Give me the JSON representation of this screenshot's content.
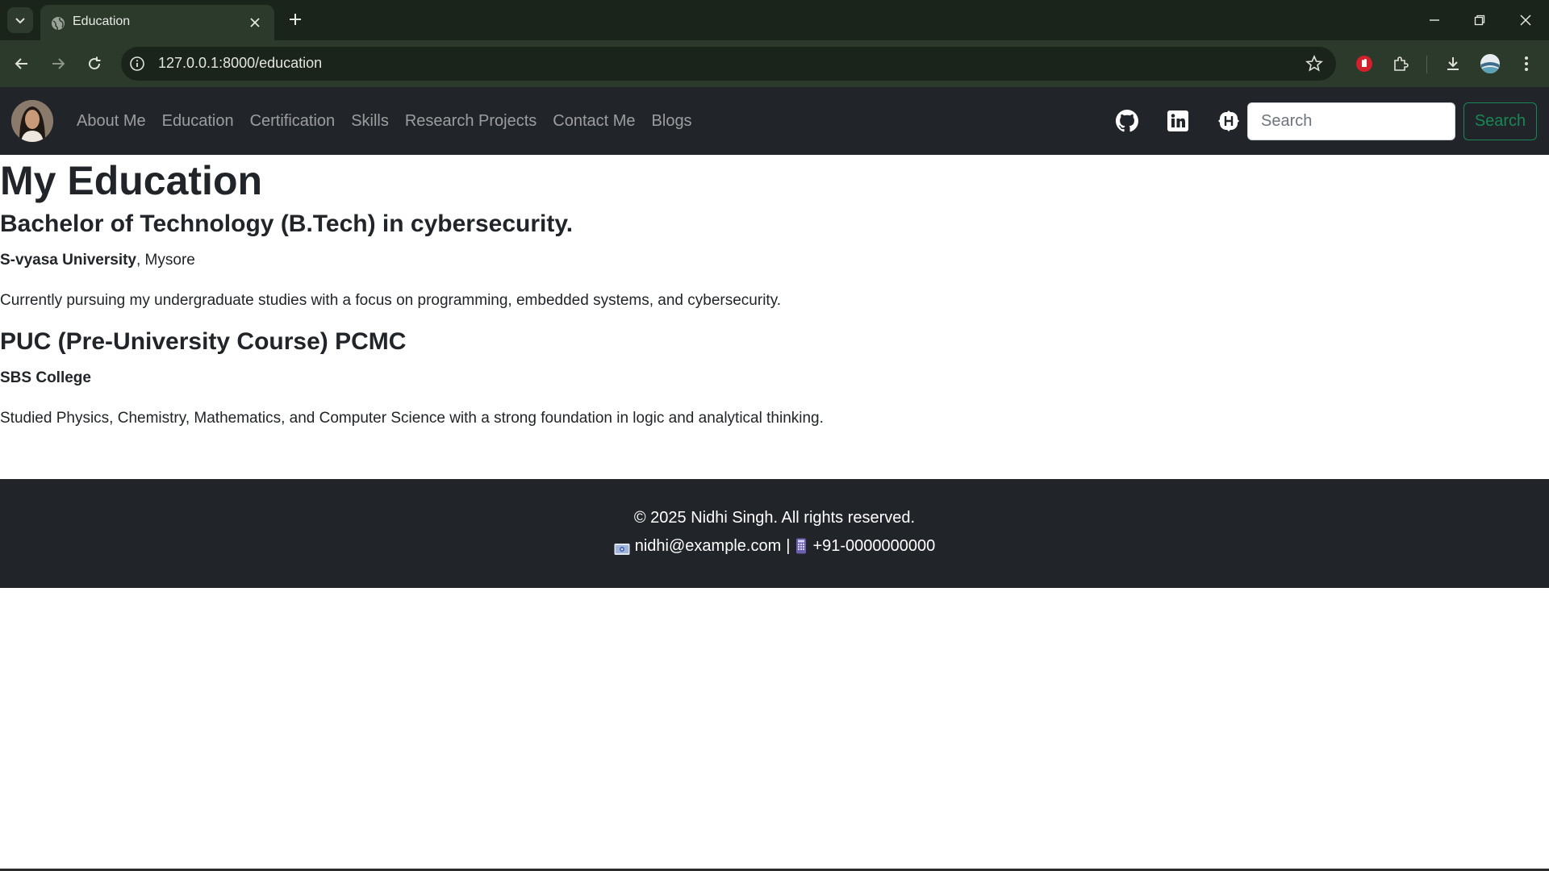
{
  "browser": {
    "tab_title": "Education",
    "url": "127.0.0.1:8000/education"
  },
  "navbar": {
    "links": [
      "About Me",
      "Education",
      "Certification",
      "Skills",
      "Research Projects",
      "Contact Me",
      "Blogs"
    ],
    "search_placeholder": "Search",
    "search_button": "Search",
    "social_icons": [
      "github-icon",
      "linkedin-icon",
      "hashnode-icon"
    ]
  },
  "page": {
    "title": "My Education",
    "entries": [
      {
        "degree": "Bachelor of Technology (B.Tech) in cybersecurity.",
        "school": "S-vyasa University",
        "location": ", Mysore",
        "description": "Currently pursuing my undergraduate studies with a focus on programming, embedded systems, and cybersecurity."
      },
      {
        "degree": "PUC (Pre-University Course) PCMC",
        "school": "SBS College",
        "location": "",
        "description": "Studied Physics, Chemistry, Mathematics, and Computer Science with a strong foundation in logic and analytical thinking."
      }
    ]
  },
  "footer": {
    "copyright": "© 2025 Nidhi Singh. All rights reserved.",
    "email": "nidhi@example.com",
    "separator": "|",
    "phone": "+91-0000000000"
  },
  "colors": {
    "navbar_bg": "#212529",
    "accent_green": "#198754",
    "chrome_dark": "#1b241b",
    "chrome_mid": "#2c3a2b"
  }
}
